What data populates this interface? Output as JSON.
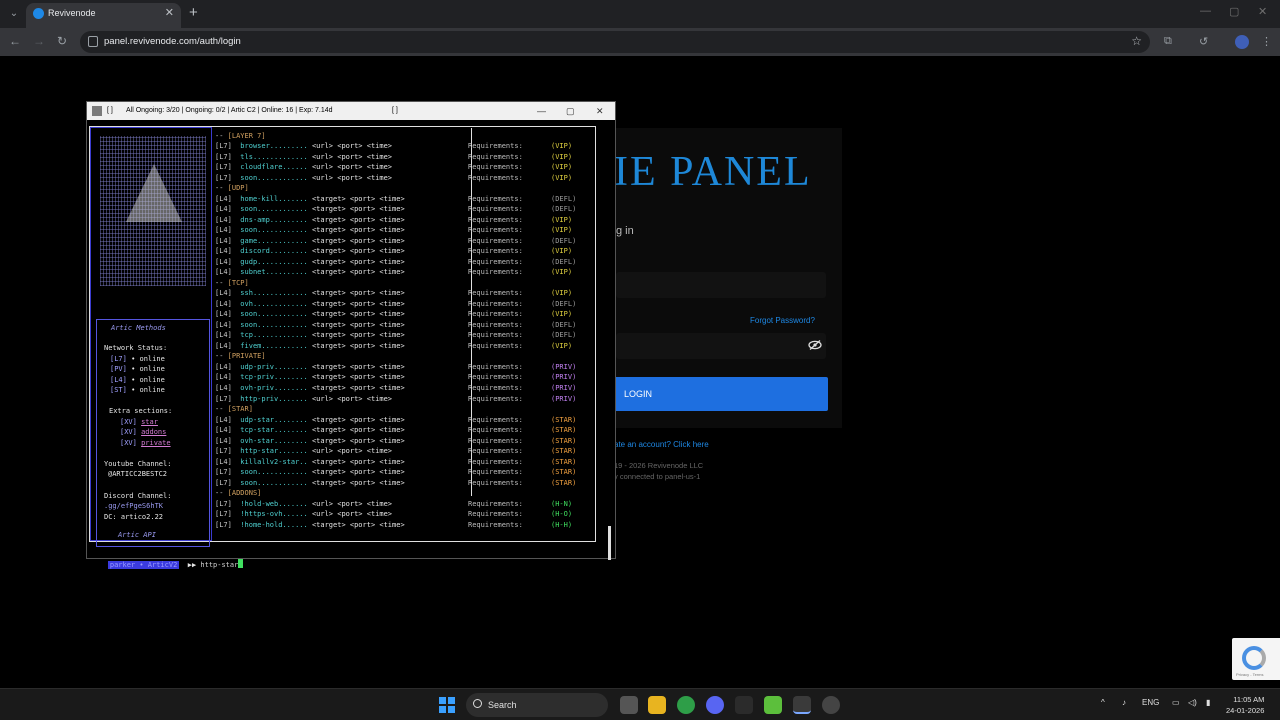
{
  "browser": {
    "tab_title": "Revivenode",
    "tab_close": "✕",
    "new_tab": "+",
    "url": "panel.revivenode.com/auth/login",
    "window_controls": [
      "—",
      "▢",
      "✕"
    ]
  },
  "page": {
    "panel_title": "IE PANEL",
    "panel_subtitle": "g in",
    "forgot_password": "Forgot Password?",
    "login_button": "LOGIN",
    "create_account": "ate an account? Click here",
    "copyright": "19 - 2026 Revivenode LLC",
    "connected": "y connected to panel-us-1",
    "recaptcha_text": "Privacy - Terms"
  },
  "terminal": {
    "title_left": "[ ]",
    "title": "All Ongoing: 3/20  |  Ongoing: 0/2  |  Artic C2  |  Online: 16  |  Exp: 7.14d",
    "title_right": "[ ]",
    "controls": [
      "—",
      "▢",
      "✕"
    ],
    "sidebar": {
      "methods_title": "Artic Methods",
      "network_status_label": "Network Status:",
      "status": [
        {
          "tag": "[L7]",
          "value": "• online"
        },
        {
          "tag": "[PV]",
          "value": "• online"
        },
        {
          "tag": "[L4]",
          "value": "• online"
        },
        {
          "tag": "[ST]",
          "value": "• online"
        }
      ],
      "extra_label": "Extra sections:",
      "extras": [
        {
          "tag": "[XV]",
          "value": "star"
        },
        {
          "tag": "[XV]",
          "value": "addons"
        },
        {
          "tag": "[XV]",
          "value": "private"
        }
      ],
      "youtube_label": "Youtube Channel:",
      "youtube_value": "@ARTICC2BESTC2",
      "discord_label": "Discord Channel:",
      "discord_value": ".gg/efPgeS6hTK",
      "dc_value": "DC: artico2.22",
      "footer": "Artic API"
    },
    "requirements_label": "Requirements:",
    "rows": [
      {
        "type": "cat",
        "text": "[LAYER 7]"
      },
      {
        "lvl": "[L7]",
        "cmd": "browser.........",
        "args": "<url> <port> <time>",
        "req": "(VIP)",
        "cls": "vip"
      },
      {
        "lvl": "[L7]",
        "cmd": "tls.............",
        "args": "<url> <port> <time>",
        "req": "(VIP)",
        "cls": "vip"
      },
      {
        "lvl": "[L7]",
        "cmd": "cloudflare......",
        "args": "<url> <port> <time>",
        "req": "(VIP)",
        "cls": "vip"
      },
      {
        "lvl": "[L7]",
        "cmd": "soon............",
        "args": "<url> <port> <time>",
        "req": "(VIP)",
        "cls": "vip"
      },
      {
        "type": "cat",
        "text": "[UDP]"
      },
      {
        "lvl": "[L4]",
        "cmd": "home-kill.......",
        "args": "<target> <port> <time>",
        "req": "(DEFL)",
        "cls": "defl"
      },
      {
        "lvl": "[L4]",
        "cmd": "soon............",
        "args": "<target> <port> <time>",
        "req": "(DEFL)",
        "cls": "defl"
      },
      {
        "lvl": "[L4]",
        "cmd": "dns-amp.........",
        "args": "<target> <port> <time>",
        "req": "(VIP)",
        "cls": "vip"
      },
      {
        "lvl": "[L4]",
        "cmd": "soon............",
        "args": "<target> <port> <time>",
        "req": "(VIP)",
        "cls": "vip"
      },
      {
        "lvl": "[L4]",
        "cmd": "game............",
        "args": "<target> <port> <time>",
        "req": "(DEFL)",
        "cls": "defl"
      },
      {
        "lvl": "[L4]",
        "cmd": "discord.........",
        "args": "<target> <port> <time>",
        "req": "(VIP)",
        "cls": "vip"
      },
      {
        "lvl": "[L4]",
        "cmd": "gudp............",
        "args": "<target> <port> <time>",
        "req": "(DEFL)",
        "cls": "defl"
      },
      {
        "lvl": "[L4]",
        "cmd": "subnet..........",
        "args": "<target> <port> <time>",
        "req": "(VIP)",
        "cls": "vip"
      },
      {
        "type": "cat",
        "text": "[TCP]"
      },
      {
        "lvl": "[L4]",
        "cmd": "ssh.............",
        "args": "<target> <port> <time>",
        "req": "(VIP)",
        "cls": "vip"
      },
      {
        "lvl": "[L4]",
        "cmd": "ovh.............",
        "args": "<target> <port> <time>",
        "req": "(DEFL)",
        "cls": "defl"
      },
      {
        "lvl": "[L4]",
        "cmd": "soon............",
        "args": "<target> <port> <time>",
        "req": "(VIP)",
        "cls": "vip"
      },
      {
        "lvl": "[L4]",
        "cmd": "soon............",
        "args": "<target> <port> <time>",
        "req": "(DEFL)",
        "cls": "defl"
      },
      {
        "lvl": "[L4]",
        "cmd": "tcp.............",
        "args": "<target> <port> <time>",
        "req": "(DEFL)",
        "cls": "defl"
      },
      {
        "lvl": "[L4]",
        "cmd": "fivem...........",
        "args": "<target> <port> <time>",
        "req": "(VIP)",
        "cls": "vip"
      },
      {
        "type": "cat",
        "text": "[PRIVATE]"
      },
      {
        "lvl": "[L4]",
        "cmd": "udp-priv........",
        "args": "<target> <port> <time>",
        "req": "(PRIV)",
        "cls": "priv"
      },
      {
        "lvl": "[L4]",
        "cmd": "tcp-priv........",
        "args": "<target> <port> <time>",
        "req": "(PRIV)",
        "cls": "priv"
      },
      {
        "lvl": "[L4]",
        "cmd": "ovh-priv........",
        "args": "<target> <port> <time>",
        "req": "(PRIV)",
        "cls": "priv"
      },
      {
        "lvl": "[L7]",
        "cmd": "http-priv.......",
        "args": "<url> <port> <time>",
        "req": "(PRIV)",
        "cls": "priv"
      },
      {
        "type": "cat",
        "text": "[STAR]"
      },
      {
        "lvl": "[L4]",
        "cmd": "udp-star........",
        "args": "<target> <port> <time>",
        "req": "(STAR)",
        "cls": "star"
      },
      {
        "lvl": "[L4]",
        "cmd": "tcp-star........",
        "args": "<target> <port> <time>",
        "req": "(STAR)",
        "cls": "star"
      },
      {
        "lvl": "[L4]",
        "cmd": "ovh-star........",
        "args": "<target> <port> <time>",
        "req": "(STAR)",
        "cls": "star"
      },
      {
        "lvl": "[L7]",
        "cmd": "http-star.......",
        "args": "<url> <port> <time>",
        "req": "(STAR)",
        "cls": "star"
      },
      {
        "lvl": "[L4]",
        "cmd": "killallv2-star..",
        "args": "<target> <port> <time>",
        "req": "(STAR)",
        "cls": "star"
      },
      {
        "lvl": "[L7]",
        "cmd": "soon............",
        "args": "<target> <port> <time>",
        "req": "(STAR)",
        "cls": "star"
      },
      {
        "lvl": "[L7]",
        "cmd": "soon............",
        "args": "<target> <port> <time>",
        "req": "(STAR)",
        "cls": "star"
      },
      {
        "type": "cat",
        "text": "[ADDONS]"
      },
      {
        "lvl": "[L7]",
        "cmd": "!hold-web.......",
        "args": "<url> <port> <time>",
        "req": "(H-N)",
        "cls": "hn"
      },
      {
        "lvl": "[L7]",
        "cmd": "!https-ovh......",
        "args": "<url> <port> <time>",
        "req": "(H-O)",
        "cls": "hn"
      },
      {
        "lvl": "[L7]",
        "cmd": "!home-hold......",
        "args": "<target> <port> <time>",
        "req": "(H-H)",
        "cls": "hn"
      }
    ],
    "prompt_user": "parker • ArticV2",
    "prompt_arrow": "▶▶",
    "prompt_input": "http-star"
  },
  "taskbar": {
    "search_label": "Search",
    "lang": "ENG",
    "time": "11:05 AM",
    "date": "24-01-2026",
    "tray_icons": [
      "chevron-up-icon",
      "mic-icon",
      "network-icon",
      "volume-icon",
      "battery-icon"
    ]
  },
  "colors": {
    "accent_blue": "#1e6fe0",
    "terminal_cyan": "#4fd0d0",
    "vip_yellow": "#e0d040",
    "priv_purple": "#c080f0",
    "star_orange": "#f0a040",
    "cursor_green": "#40e060"
  }
}
